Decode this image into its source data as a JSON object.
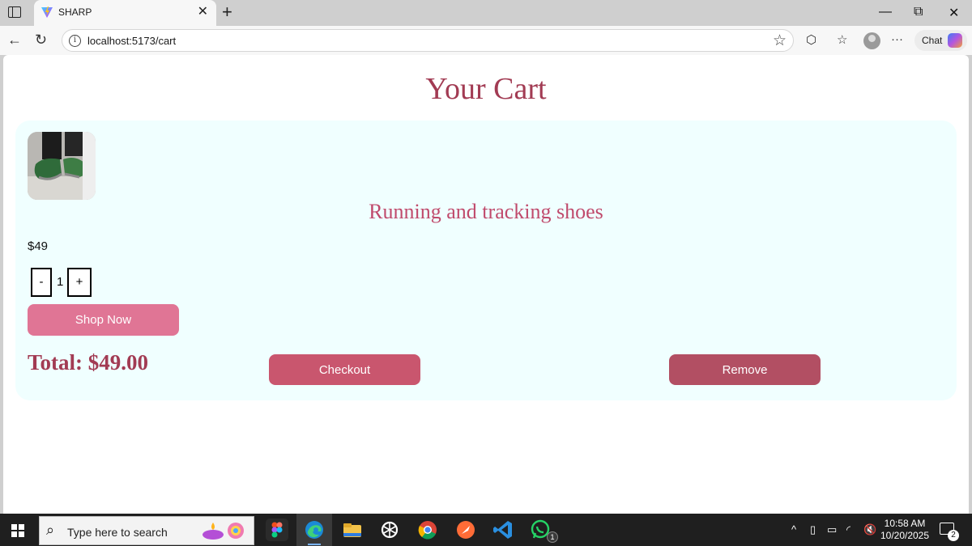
{
  "browser": {
    "tab_title": "SHARP",
    "tab_close": "✕",
    "new_tab": "+",
    "url": "localhost:5173/cart",
    "chat_label": "Chat",
    "window_controls": {
      "minimize": "—",
      "restore": "⧉",
      "close": "✕"
    }
  },
  "page": {
    "title": "Your Cart",
    "item": {
      "name": "Running and tracking shoes",
      "price": "$49",
      "quantity": "1",
      "decrement_label": "-",
      "increment_label": "+",
      "shop_label": "Shop Now"
    },
    "total": "Total: $49.00",
    "checkout_label": "Checkout",
    "remove_label": "Remove"
  },
  "taskbar": {
    "search_placeholder": "Type here to search",
    "time": "10:58 AM",
    "date": "10/20/2025",
    "whatsapp_badge": "1",
    "notification_count": "2"
  },
  "colors": {
    "title": "#a23b53",
    "product_name": "#c04a6c",
    "card_bg": "#f0ffff",
    "shop_button": "#e07595",
    "checkout_button": "#c9566e",
    "remove_button": "#b24f63"
  }
}
